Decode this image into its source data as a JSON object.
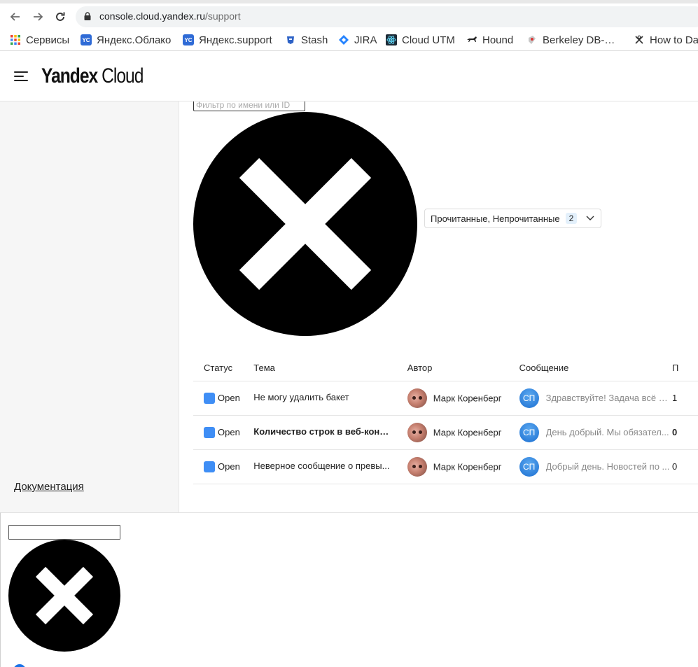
{
  "browser": {
    "url_host": "console.cloud.yandex.ru",
    "url_path": "/support",
    "bookmarks": [
      {
        "label": "Сервисы",
        "icon": "apps-grid-icon"
      },
      {
        "label": "Яндекс.Облако",
        "icon": "yc-icon"
      },
      {
        "label": "Яндекс.support",
        "icon": "yc-icon"
      },
      {
        "label": "Stash",
        "icon": "stash-icon"
      },
      {
        "label": "JIRA",
        "icon": "jira-icon"
      },
      {
        "label": "Cloud UTM",
        "icon": "react-icon"
      },
      {
        "label": "Hound",
        "icon": "hound-icon"
      },
      {
        "label": "Berkeley DB-…",
        "icon": "berkeley-icon"
      },
      {
        "label": "How to Da",
        "icon": "cross-tool-icon"
      }
    ]
  },
  "header": {
    "logo_bold": "Yandex",
    "logo_light": "Cloud"
  },
  "sidebar": {
    "doc_link": "Документация"
  },
  "filters": {
    "search_placeholder": "Фильтр по имени или ID",
    "read_status_label": "Прочитанные, Непрочитанные",
    "read_status_count": "2"
  },
  "table": {
    "columns": [
      "Статус",
      "Тема",
      "Автор",
      "Сообщение",
      "П"
    ],
    "rows": [
      {
        "status": "Open",
        "topic": "Не могу удалить бакет",
        "bold": false,
        "author": "Марк Коренберг",
        "sp": "СП",
        "message": "Здравствуйте! Задача всё е...",
        "extra": "1"
      },
      {
        "status": "Open",
        "topic": "Количество строк в веб-консо...",
        "bold": true,
        "author": "Марк Коренберг",
        "sp": "СП",
        "message": "День добрый. Мы обязател...",
        "extra": "0"
      },
      {
        "status": "Open",
        "topic": "Неверное сообщение о превы...",
        "bold": false,
        "author": "Марк Коренберг",
        "sp": "СП",
        "message": "Добрый день. Новостей по ...",
        "extra": "0"
      }
    ]
  },
  "colors": {
    "status_open": "#3f8ef5",
    "support_avatar": "#1c6fd1"
  }
}
